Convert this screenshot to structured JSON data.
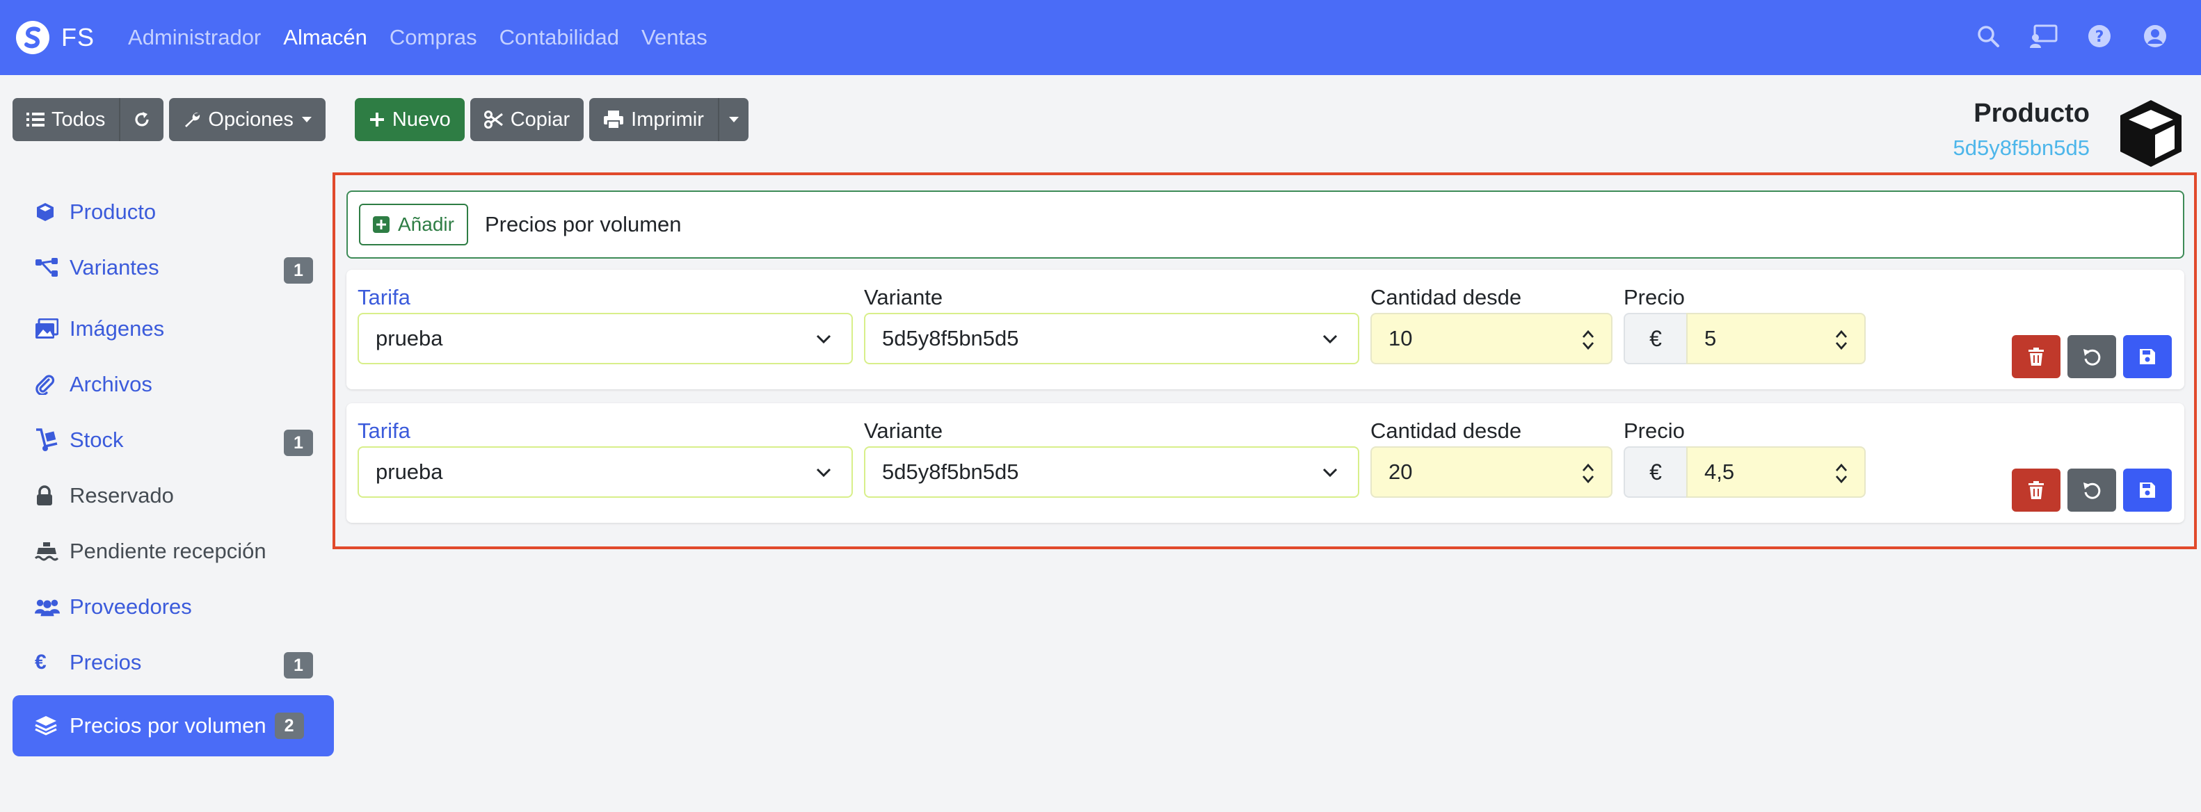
{
  "navbar": {
    "brand": "FS",
    "menu": [
      {
        "label": "Administrador",
        "active": false
      },
      {
        "label": "Almacén",
        "active": true
      },
      {
        "label": "Compras",
        "active": false
      },
      {
        "label": "Contabilidad",
        "active": false
      },
      {
        "label": "Ventas",
        "active": false
      }
    ]
  },
  "toolbar": {
    "all_label": "Todos",
    "options_label": "Opciones",
    "new_label": "Nuevo",
    "copy_label": "Copiar",
    "print_label": "Imprimir"
  },
  "product": {
    "title": "Producto",
    "code": "5d5y8f5bn5d5"
  },
  "sidebar": {
    "items": [
      {
        "label": "Producto",
        "icon": "cube-icon",
        "badge": ""
      },
      {
        "label": "Variantes",
        "icon": "sitemap-icon",
        "badge": "1"
      },
      {
        "label": "Imágenes",
        "icon": "images-icon",
        "badge": ""
      },
      {
        "label": "Archivos",
        "icon": "paperclip-icon",
        "badge": ""
      },
      {
        "label": "Stock",
        "icon": "dolly-icon",
        "badge": "1"
      },
      {
        "label": "Reservado",
        "icon": "lock-icon",
        "badge": ""
      },
      {
        "label": "Pendiente recepción",
        "icon": "ship-icon",
        "badge": ""
      },
      {
        "label": "Proveedores",
        "icon": "users-icon",
        "badge": ""
      },
      {
        "label": "Precios",
        "icon": "euro-icon",
        "badge": "1"
      },
      {
        "label": "Precios por volumen",
        "icon": "layers-icon",
        "badge": "2"
      }
    ]
  },
  "panel": {
    "add_label": "Añadir",
    "title": "Precios por volumen",
    "labels": {
      "tarifa": "Tarifa",
      "variante": "Variante",
      "cantidad": "Cantidad desde",
      "precio": "Precio"
    },
    "currency": "€",
    "rows": [
      {
        "tarifa": "prueba",
        "variante": "5d5y8f5bn5d5",
        "cantidad": "10",
        "precio": "5"
      },
      {
        "tarifa": "prueba",
        "variante": "5d5y8f5bn5d5",
        "cantidad": "20",
        "precio": "4,5"
      }
    ]
  },
  "colors": {
    "navbar": "#4a6cf7",
    "accent_link": "#3b5bdb",
    "panel_border": "#e14a2c",
    "success": "#2e7d44",
    "danger": "#c0392b"
  }
}
